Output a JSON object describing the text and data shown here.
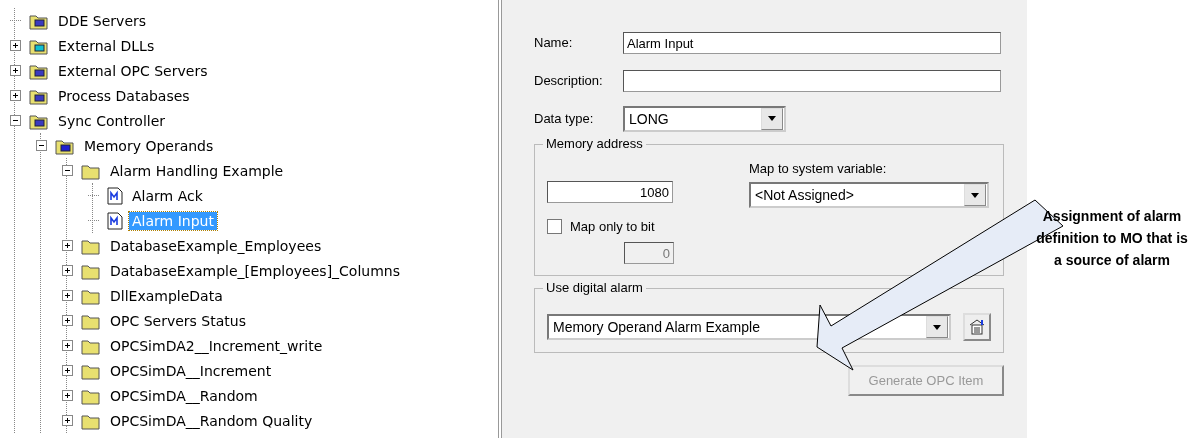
{
  "tree": [
    {
      "label": "DDE Servers",
      "kind": "server",
      "selected": false
    },
    {
      "label": "External DLLs",
      "kind": "dll",
      "expanded": false,
      "selected": false
    },
    {
      "label": "External OPC Servers",
      "kind": "server",
      "expanded": false,
      "selected": false
    },
    {
      "label": "Process Databases",
      "kind": "database",
      "expanded": false,
      "selected": false
    },
    {
      "label": "Sync Controller",
      "kind": "controller",
      "expanded": true,
      "selected": false,
      "children": [
        {
          "label": "Memory Operands",
          "kind": "memory",
          "expanded": true,
          "selected": false,
          "children": [
            {
              "label": "Alarm Handling Example",
              "kind": "folder",
              "expanded": true,
              "selected": false,
              "children": [
                {
                  "label": "Alarm Ack",
                  "kind": "operand",
                  "selected": false
                },
                {
                  "label": "Alarm Input",
                  "kind": "operand",
                  "selected": true
                }
              ]
            },
            {
              "label": "DatabaseExample_Employees",
              "kind": "folder",
              "expanded": false,
              "selected": false
            },
            {
              "label": "DatabaseExample_[Employees]_Columns",
              "kind": "folder",
              "expanded": false,
              "selected": false
            },
            {
              "label": "DllExampleData",
              "kind": "folder",
              "expanded": false,
              "selected": false
            },
            {
              "label": "OPC Servers Status",
              "kind": "folder",
              "expanded": false,
              "selected": false
            },
            {
              "label": "OPCSimDA2__Increment_write",
              "kind": "folder",
              "expanded": false,
              "selected": false
            },
            {
              "label": "OPCSimDA__Increment",
              "kind": "folder",
              "expanded": false,
              "selected": false
            },
            {
              "label": "OPCSimDA__Random",
              "kind": "folder",
              "expanded": false,
              "selected": false
            },
            {
              "label": "OPCSimDA__Random Quality",
              "kind": "folder",
              "expanded": false,
              "selected": false
            }
          ]
        }
      ]
    }
  ],
  "form": {
    "name_label": "Name:",
    "name_value": "Alarm Input",
    "description_label": "Description:",
    "data_type_label": "Data type:",
    "data_type_value": "LONG",
    "memory_group": "Memory address",
    "address_value": "1080",
    "map_label": "Map to system variable:",
    "map_value": "<Not Assigned>",
    "bit_checkbox": {
      "label": "Map only to bit",
      "checked": false
    },
    "bit_value": "0",
    "alarm_group": "Use digital alarm",
    "alarm_value": "Memory Operand Alarm Example",
    "generate_button": {
      "label": "Generate OPC Item",
      "disabled": true
    }
  },
  "annotation": "Assignment of alarm definition to MO that is a source of alarm"
}
